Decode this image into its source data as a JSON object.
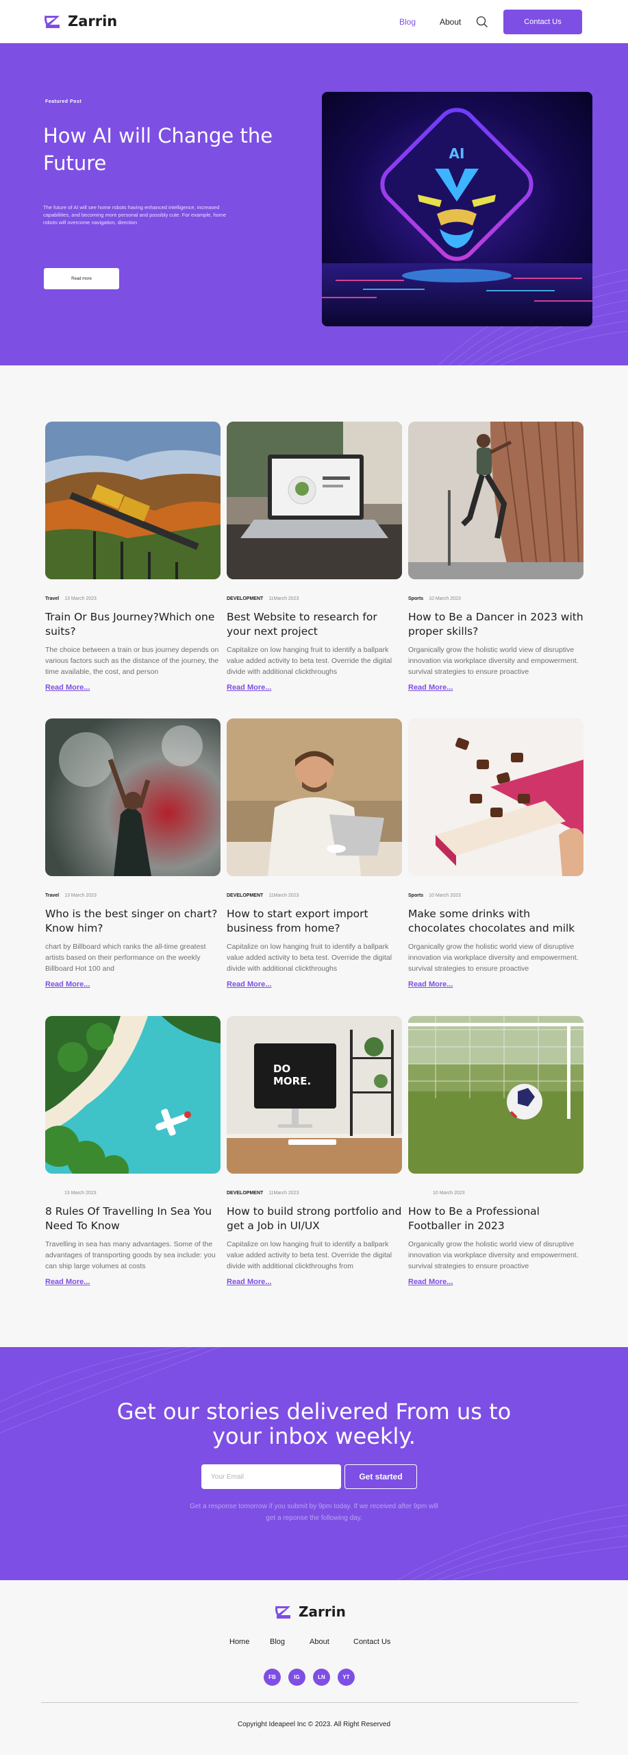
{
  "nav": {
    "brand": "Zarrin",
    "links": [
      "Blog",
      "About"
    ],
    "contact_label": "Contact Us"
  },
  "hero": {
    "kicker": "Featured Post",
    "title": "How AI will Change the Future",
    "description": "The future of AI will see home robots having enhanced intelligence, increased capabilities, and becoming more personal and possibly cute. For example, home robots will overcome navigation, direction",
    "button_label": "Read more",
    "image_text": "AI"
  },
  "posts": [
    {
      "category": "Travel",
      "date": "13 March 2023",
      "title": "Train Or Bus Journey?Which one suits?",
      "excerpt": "The choice between a train or bus journey depends on various factors such as the distance of the journey, the time available, the cost, and person",
      "more": "Read More..."
    },
    {
      "category": "DEVELOPMENT",
      "date": "11March 2023",
      "title": "Best Website to research for your next project",
      "excerpt": "Capitalize on low hanging fruit to identify a ballpark value added activity to beta test. Override the digital divide with additional clickthroughs",
      "more": "Read More..."
    },
    {
      "category": "Sports",
      "date": "10 March 2023",
      "title": "How to Be a Dancer in 2023 with proper skills?",
      "excerpt": "Organically grow the holistic world view of disruptive innovation via workplace diversity and empowerment. survival strategies to ensure proactive",
      "more": "Read More..."
    },
    {
      "category": "Travel",
      "date": "13 March 2023",
      "title": "Who is the best singer on chart? Know him?",
      "excerpt": "chart by Billboard which ranks the all-time greatest artists based on their performance on the weekly Billboard Hot 100 and",
      "more": "Read More..."
    },
    {
      "category": "DEVELOPMENT",
      "date": "11March 2023",
      "title": "How to start export import business from home?",
      "excerpt": "Capitalize on low hanging fruit to identify a ballpark value added activity to beta test. Override the digital divide with additional clickthroughs",
      "more": "Read More..."
    },
    {
      "category": "Sports",
      "date": "10 March 2023",
      "title": "Make some drinks with chocolates chocolates and milk",
      "excerpt": "Organically grow the holistic world view of disruptive innovation via workplace diversity and empowerment. survival strategies to ensure proactive",
      "more": "Read More..."
    },
    {
      "category": "",
      "date": "13 March 2023",
      "title": "8 Rules Of Travelling In Sea You Need To Know",
      "excerpt": "Travelling in sea has many advantages. Some of the advantages of transporting goods by sea include: you can ship large volumes at costs",
      "more": "Read More..."
    },
    {
      "category": "DEVELOPMENT",
      "date": "11March 2023",
      "title": "How to build strong portfolio and get a Job in UI/UX",
      "excerpt": "Capitalize on low hanging fruit to identify a ballpark value added activity to beta test. Override the digital divide with additional clickthroughs from",
      "more": "Read More..."
    },
    {
      "category": "",
      "date": "10 March 2023",
      "title": "How to Be a Professional Footballer in 2023",
      "excerpt": "Organically grow the holistic world view of disruptive innovation via workplace diversity and empowerment. survival strategies to ensure proactive",
      "more": "Read More..."
    }
  ],
  "post_images": {
    "desk_line1": "DO",
    "desk_line2": "MORE."
  },
  "newsletter": {
    "title": "Get our stories delivered From us to your inbox weekly.",
    "email_placeholder": "Your Email",
    "button_label": "Get started",
    "note": "Get a response tomorrow if you submit by 9pm today. If we received after 9pm will get a reponse the following day."
  },
  "footer": {
    "brand": "Zarrin",
    "links": [
      "Home",
      "Blog",
      "About",
      "Contact Us"
    ],
    "socials": [
      "FB",
      "IG",
      "LN",
      "YT"
    ],
    "copyright": "Copyright Ideapeel Inc © 2023. All Right Reserved"
  },
  "colors": {
    "accent": "#7e4fe4",
    "accent_text": "#7d4fe3",
    "background": "#f7f7f7",
    "text": "#1e1e1e",
    "muted": "#6f6f6f"
  },
  "icons": [
    "zarrin-logo-icon",
    "search-icon"
  ]
}
